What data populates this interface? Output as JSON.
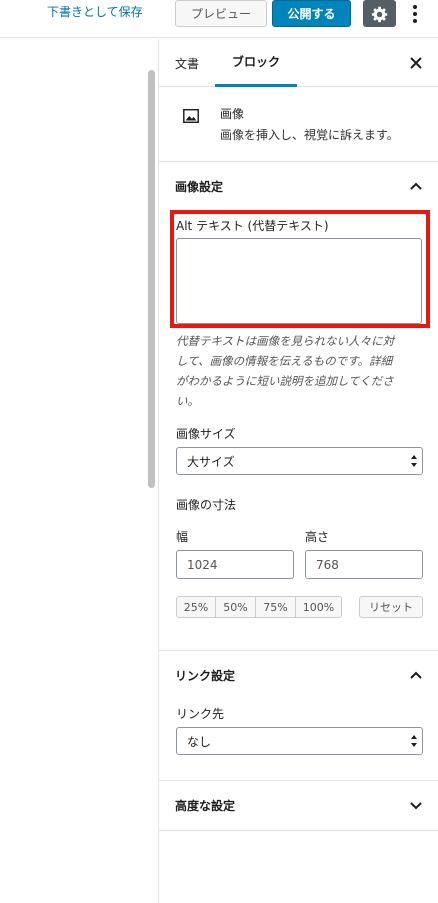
{
  "header": {
    "save_draft": "下書きとして保存",
    "preview": "プレビュー",
    "publish": "公開する"
  },
  "sidebar": {
    "tabs": [
      "文書",
      "ブロック"
    ],
    "block": {
      "title": "画像",
      "description": "画像を挿入し、視覚に訴えます。"
    },
    "image_settings": {
      "title": "画像設定",
      "alt_label": "Alt テキスト (代替テキスト)",
      "alt_value": "",
      "help_line1": "代替テキストは画像を見られない人々に対",
      "help_line2": "して、画像の情報を伝えるものです。詳細",
      "help_line3": "がわかるように短い説明を追加してくださ",
      "help_line4": "い。",
      "size_label": "画像サイズ",
      "size_value": "大サイズ",
      "dimensions_label": "画像の寸法",
      "width_label": "幅",
      "height_label": "高さ",
      "width_value": "1024",
      "height_value": "768",
      "percent_buttons": [
        "25%",
        "50%",
        "75%",
        "100%"
      ],
      "reset": "リセット"
    },
    "link_settings": {
      "title": "リンク設定",
      "link_to_label": "リンク先",
      "link_to_value": "なし"
    },
    "advanced": {
      "title": "高度な設定"
    }
  },
  "colors": {
    "accent": "#0085ba",
    "highlight": "#e8170f",
    "link": "#0073aa"
  }
}
